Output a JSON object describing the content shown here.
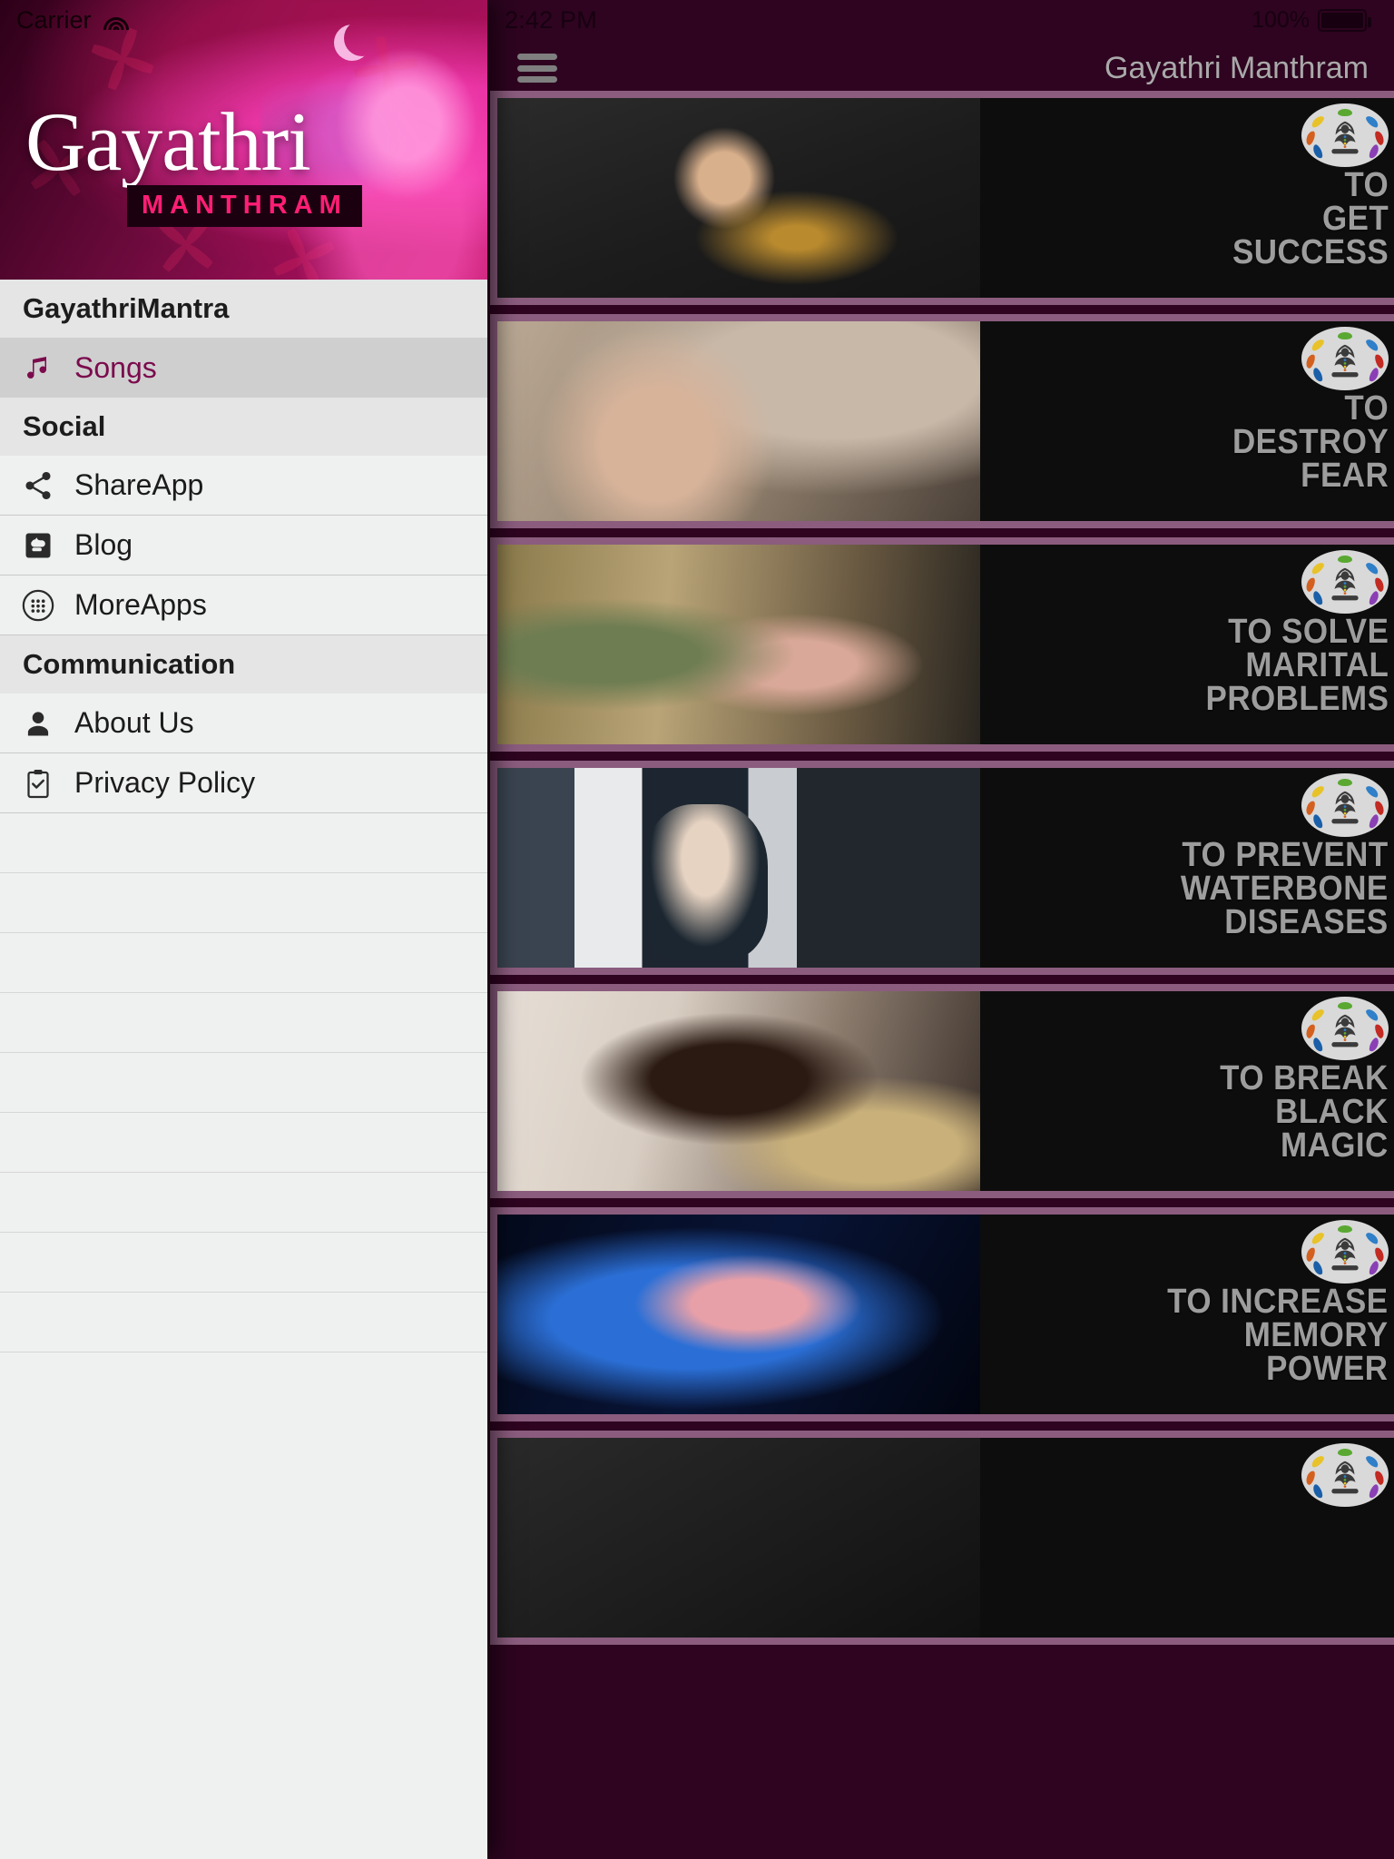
{
  "status_bar": {
    "carrier": "Carrier",
    "wifi_icon": "wifi-icon",
    "time": "2:42 PM",
    "battery_percent": "100%",
    "battery_icon": "battery-full-icon"
  },
  "navbar": {
    "menu_icon": "hamburger-menu-icon",
    "title": "Gayathri Manthram"
  },
  "drawer": {
    "brand_title": "Gayathri",
    "brand_subtitle": "MANTHRAM",
    "sections": [
      {
        "header": "GayathriMantra",
        "items": [
          {
            "label": "Songs",
            "icon": "music-note-icon",
            "selected": true
          }
        ]
      },
      {
        "header": "Social",
        "items": [
          {
            "label": "ShareApp",
            "icon": "share-icon",
            "selected": false
          },
          {
            "label": "Blog",
            "icon": "blogger-icon",
            "selected": false
          },
          {
            "label": "MoreApps",
            "icon": "apps-grid-icon",
            "selected": false
          }
        ]
      },
      {
        "header": "Communication",
        "items": [
          {
            "label": "About Us",
            "icon": "person-icon",
            "selected": false
          },
          {
            "label": "Privacy Policy",
            "icon": "clipboard-check-icon",
            "selected": false
          }
        ]
      }
    ],
    "empty_rows": 9
  },
  "cards": [
    {
      "lines": [
        "TO",
        "GET",
        "SUCCESS"
      ],
      "photo": "ph-success",
      "logo": "lotus-meditation-logo"
    },
    {
      "lines": [
        "TO",
        "DESTROY",
        "FEAR"
      ],
      "photo": "ph-fear",
      "logo": "lotus-meditation-logo"
    },
    {
      "lines": [
        "TO SOLVE",
        "MARITAL",
        "PROBLEMS"
      ],
      "photo": "ph-marital",
      "logo": "lotus-meditation-logo"
    },
    {
      "lines": [
        "TO PREVENT",
        "WATERBONE",
        "DISEASES"
      ],
      "photo": "ph-water",
      "logo": "lotus-meditation-logo"
    },
    {
      "lines": [
        "TO BREAK",
        "BLACK",
        "MAGIC"
      ],
      "photo": "ph-magic",
      "logo": "lotus-meditation-logo"
    },
    {
      "lines": [
        "TO INCREASE",
        "MEMORY",
        "POWER"
      ],
      "photo": "ph-memory",
      "logo": "lotus-meditation-logo"
    },
    {
      "lines": [],
      "photo": "ph-extra",
      "logo": "lotus-meditation-logo"
    }
  ],
  "colors": {
    "brand_magenta": "#ff1e74",
    "accent_purple": "#7b0b4d",
    "card_border": "#8b5c7e",
    "app_background": "#2e0420",
    "drawer_background": "#eff0f0",
    "caption_gray": "#9d9d9d"
  },
  "logo_leaf_colors": [
    "#e8c229",
    "#5aa832",
    "#2f7fc9",
    "#d4601f",
    "#c22a22",
    "#1a5fa8",
    "#8a3fb5"
  ]
}
